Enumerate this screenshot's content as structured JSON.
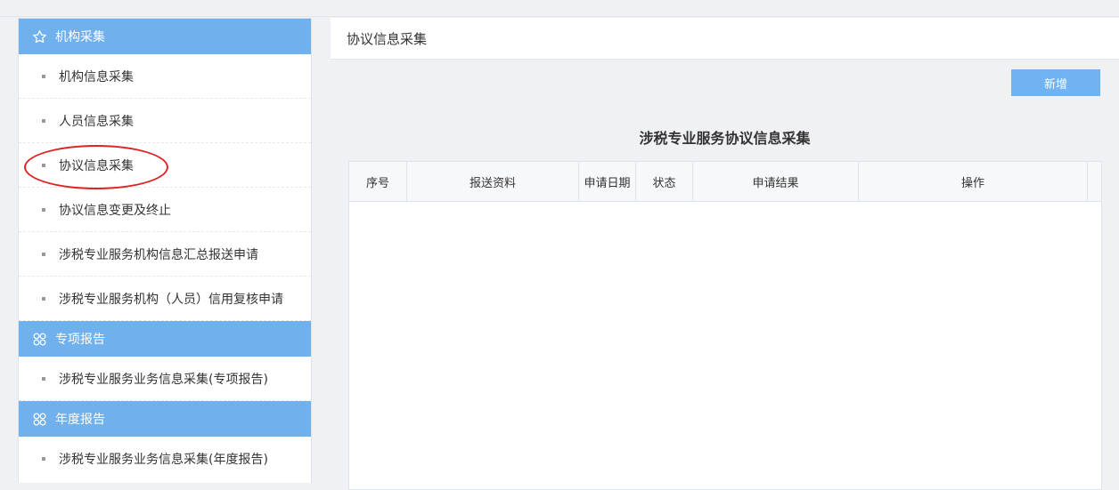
{
  "sidebar": {
    "groups": [
      {
        "title": "机构采集",
        "icon": "star-icon",
        "items": [
          {
            "label": "机构信息采集"
          },
          {
            "label": "人员信息采集"
          },
          {
            "label": "协议信息采集"
          },
          {
            "label": "协议信息变更及终止"
          },
          {
            "label": "涉税专业服务机构信息汇总报送申请"
          },
          {
            "label": "涉税专业服务机构（人员）信用复核申请"
          }
        ]
      },
      {
        "title": "专项报告",
        "icon": "grid-icon",
        "items": [
          {
            "label": "涉税专业服务业务信息采集(专项报告)"
          }
        ]
      },
      {
        "title": "年度报告",
        "icon": "grid-icon",
        "items": [
          {
            "label": "涉税专业服务业务信息采集(年度报告)"
          }
        ]
      }
    ],
    "accent_color": "#70b0ec",
    "highlight_color": "#e02222"
  },
  "main": {
    "breadcrumb_title": "协议信息采集",
    "add_button_label": "新增",
    "table_title": "涉税专业服务协议信息采集",
    "columns": [
      "序号",
      "报送资料",
      "申请日期",
      "状态",
      "申请结果",
      "操作"
    ],
    "rows": []
  }
}
